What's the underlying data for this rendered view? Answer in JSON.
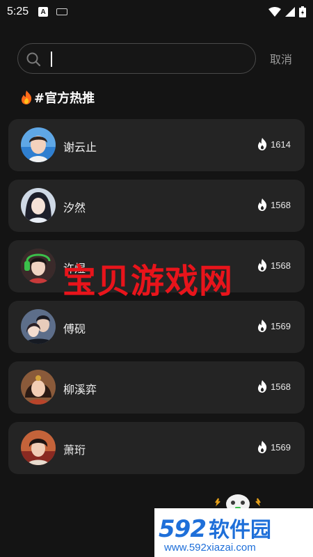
{
  "status_bar": {
    "time": "5:25",
    "a_badge": "A"
  },
  "search": {
    "value": "",
    "placeholder": "",
    "cancel_label": "取消"
  },
  "section": {
    "title": "#官方热推"
  },
  "items": [
    {
      "name": "谢云止",
      "heat": "1614"
    },
    {
      "name": "汐然",
      "heat": "1568"
    },
    {
      "name": "许煜",
      "heat": "1568"
    },
    {
      "name": "傅砚",
      "heat": "1569"
    },
    {
      "name": "柳溪弈",
      "heat": "1568"
    },
    {
      "name": "萧珩",
      "heat": "1569"
    }
  ],
  "watermark": {
    "text": "宝贝游戏网"
  },
  "logo": {
    "number": "592",
    "name": "软件园",
    "url": "www.592xiazai.com"
  },
  "colors": {
    "background": "#141414",
    "card": "#242424",
    "watermark": "#e8141b",
    "logo_blue": "#1e6fd9"
  }
}
